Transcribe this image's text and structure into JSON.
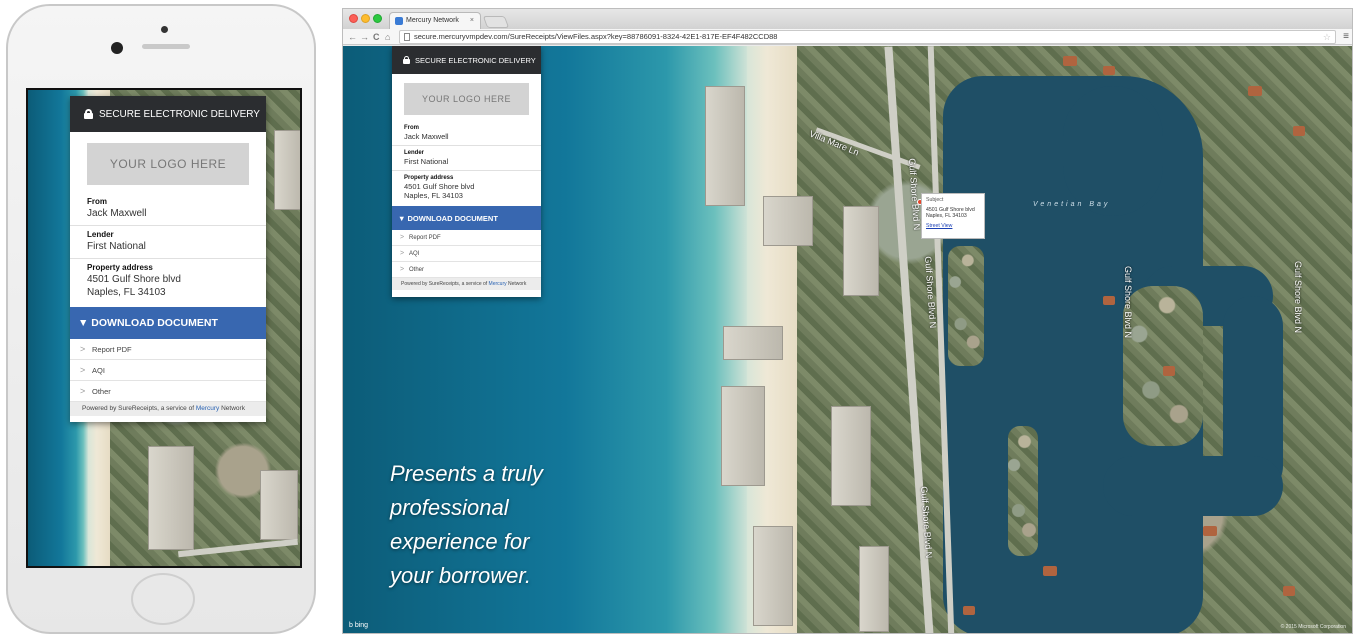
{
  "card": {
    "header": "SECURE ELECTRONIC DELIVERY",
    "logo_placeholder": "YOUR LOGO HERE",
    "fields": [
      {
        "label": "From",
        "value": "Jack Maxwell"
      },
      {
        "label": "Lender",
        "value": "First National"
      },
      {
        "label": "Property address",
        "value": "4501 Gulf Shore blvd",
        "value2": "Naples, FL 34103"
      }
    ],
    "download_label": "▼ DOWNLOAD DOCUMENT",
    "documents": [
      "Report PDF",
      "AQI",
      "Other"
    ],
    "footer_prefix": "Powered by SureReceipts, a service of ",
    "footer_brand": "Mercury",
    "footer_suffix": " Network"
  },
  "browser": {
    "tab_title": "Mercury Network",
    "tab_close": "×",
    "url": "secure.mercuryvmpdev.com/SureReceipts/ViewFiles.aspx?key=88786091-8324-42E1-817E-EF4F482CCD88",
    "nav_back": "←",
    "nav_forward": "→",
    "nav_reload": "C",
    "nav_home": "⌂",
    "menu": "≡"
  },
  "map": {
    "popup_title": "Subject",
    "popup_line1": "4501 Gulf Shore blvd",
    "popup_line2": "Naples, FL 34103",
    "popup_link": "Street View",
    "bay_label": "Venetian Bay",
    "streets": [
      "Gulf Shore Blvd N",
      "Villa Mare Ln",
      "Gulf Shore Blvd N",
      "Gulf Shore Blvd N",
      "Gulf Shore Blvd N",
      "Gulf Shore Blvd N"
    ],
    "bing": "b bing"
  },
  "tagline": [
    "Presents a truly",
    "professional",
    "experience for",
    "your borrower."
  ],
  "colors": {
    "header_bg": "#2b2d30",
    "download_bg": "#3867b0",
    "brand_link": "#2a63b3"
  }
}
